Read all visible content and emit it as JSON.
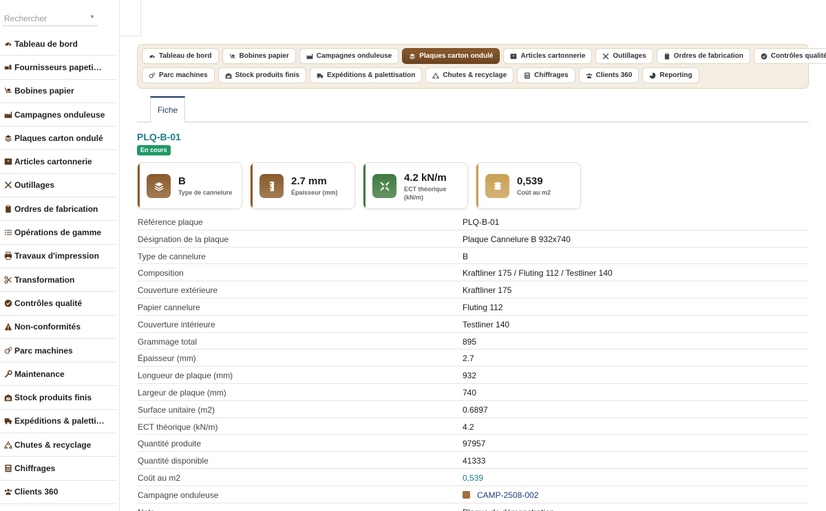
{
  "search": {
    "placeholder": "Rechercher"
  },
  "sidebar": {
    "items": [
      {
        "label": "Tableau de bord",
        "icon": "gauge-icon"
      },
      {
        "label": "Fournisseurs papeti…",
        "icon": "truck-loading-icon"
      },
      {
        "label": "Bobines papier",
        "icon": "dolly-icon"
      },
      {
        "label": "Campagnes onduleuse",
        "icon": "industry-icon"
      },
      {
        "label": "Plaques carton ondulé",
        "icon": "layer-group-icon"
      },
      {
        "label": "Articles cartonnerie",
        "icon": "box-icon"
      },
      {
        "label": "Outillages",
        "icon": "tools-icon"
      },
      {
        "label": "Ordres de fabrication",
        "icon": "clipboard-icon"
      },
      {
        "label": "Opérations de gamme",
        "icon": "list-icon"
      },
      {
        "label": "Travaux d'impression",
        "icon": "printer-icon"
      },
      {
        "label": "Transformation",
        "icon": "scissors-icon"
      },
      {
        "label": "Contrôles qualité",
        "icon": "check-circle-icon"
      },
      {
        "label": "Non-conformités",
        "icon": "warning-icon"
      },
      {
        "label": "Parc machines",
        "icon": "cogs-icon"
      },
      {
        "label": "Maintenance",
        "icon": "wrench-icon"
      },
      {
        "label": "Stock produits finis",
        "icon": "warehouse-icon"
      },
      {
        "label": "Expéditions & paletti…",
        "icon": "shipping-truck-icon"
      },
      {
        "label": "Chutes & recyclage",
        "icon": "recycle-icon"
      },
      {
        "label": "Chiffrages",
        "icon": "calculator-icon"
      },
      {
        "label": "Clients 360",
        "icon": "users-icon"
      }
    ]
  },
  "module_nav": {
    "row1": [
      {
        "label": "Tableau de bord",
        "icon": "gauge-icon"
      },
      {
        "label": "Bobines papier",
        "icon": "dolly-icon"
      },
      {
        "label": "Campagnes onduleuse",
        "icon": "industry-icon"
      },
      {
        "label": "Plaques carton ondulé",
        "icon": "layer-group-icon",
        "active": true
      },
      {
        "label": "Articles cartonnerie",
        "icon": "box-icon"
      },
      {
        "label": "Outillages",
        "icon": "tools-icon"
      },
      {
        "label": "Ordres de fabrication",
        "icon": "clipboard-icon"
      },
      {
        "label": "Contrôles qualité",
        "icon": "check-circle-icon"
      }
    ],
    "row2": [
      {
        "label": "Parc machines",
        "icon": "cogs-icon"
      },
      {
        "label": "Stock produits finis",
        "icon": "warehouse-icon"
      },
      {
        "label": "Expéditions & palettisation",
        "icon": "shipping-truck-icon"
      },
      {
        "label": "Chutes & recyclage",
        "icon": "recycle-icon"
      },
      {
        "label": "Chiffrages",
        "icon": "calculator-icon"
      },
      {
        "label": "Clients 360",
        "icon": "users-icon"
      },
      {
        "label": "Reporting",
        "icon": "pie-chart-icon"
      }
    ]
  },
  "tabs": {
    "fiche": "Fiche"
  },
  "record": {
    "title": "PLQ-B-01",
    "status": "En cours"
  },
  "kpis": [
    {
      "value": "B",
      "label": "Type de cannelure",
      "icon": "layer-group-icon",
      "color": "#8a5a2b"
    },
    {
      "value": "2.7 mm",
      "label": "Épaisseur (mm)",
      "icon": "ruler-icon",
      "color": "#8a5a2b"
    },
    {
      "value": "4.2 kN/m",
      "label": "ECT théorique (kN/m)",
      "icon": "compress-icon",
      "color": "#3f7a3f"
    },
    {
      "value": "0,539",
      "label": "Coût au m2",
      "icon": "coins-icon",
      "color": "#c9a055"
    }
  ],
  "details": [
    {
      "label": "Référence plaque",
      "value": "PLQ-B-01"
    },
    {
      "label": "Désignation de la plaque",
      "value": "Plaque Cannelure B 932x740"
    },
    {
      "label": "Type de cannelure",
      "value": "B"
    },
    {
      "label": "Composition",
      "value": "Kraftliner 175 / Fluting 112 / Testliner 140"
    },
    {
      "label": "Couverture extérieure",
      "value": "Kraftliner 175"
    },
    {
      "label": "Papier cannelure",
      "value": "Fluting 112"
    },
    {
      "label": "Couverture intérieure",
      "value": "Testliner 140"
    },
    {
      "label": "Grammage total",
      "value": "895"
    },
    {
      "label": "Épaisseur (mm)",
      "value": "2.7"
    },
    {
      "label": "Longueur de plaque (mm)",
      "value": "932"
    },
    {
      "label": "Largeur de plaque (mm)",
      "value": "740"
    },
    {
      "label": "Surface unitaire (m2)",
      "value": "0.6897"
    },
    {
      "label": "ECT théorique (kN/m)",
      "value": "4.2"
    },
    {
      "label": "Quantité produite",
      "value": "97957"
    },
    {
      "label": "Quantité disponible",
      "value": "41333"
    },
    {
      "label": "Coût au m2",
      "value": "0,539"
    },
    {
      "label": "Campagne onduleuse",
      "value": "CAMP-2508-002"
    },
    {
      "label": "Note",
      "value": "Plaque de démonstration"
    }
  ]
}
